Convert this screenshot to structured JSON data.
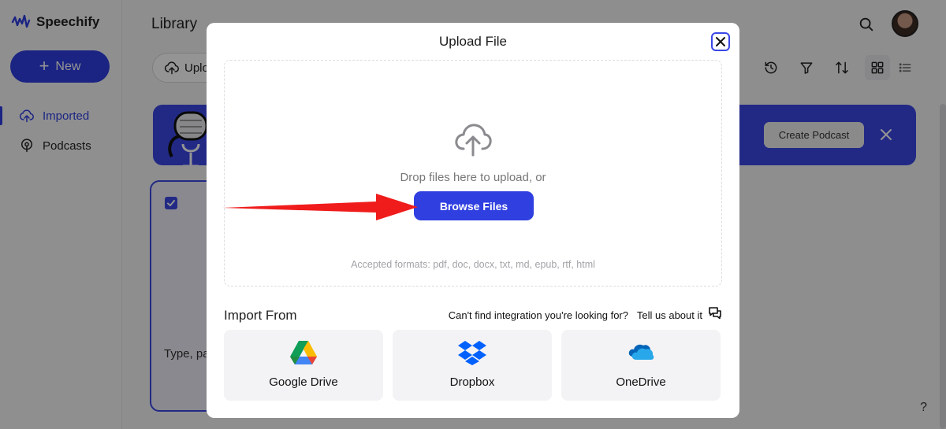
{
  "app": {
    "brand": "Speechify",
    "new_label": "New",
    "nav": [
      {
        "label": "Imported",
        "icon": "upload-cloud-icon",
        "active": true
      },
      {
        "label": "Podcasts",
        "icon": "podcast-icon",
        "active": false
      }
    ],
    "page_title": "Library",
    "upload_label": "Uplo",
    "toolbar_icons": [
      "history-icon",
      "filter-icon",
      "sort-icon",
      "grid-view-icon",
      "list-view-icon"
    ],
    "banner": {
      "create_label": "Create Podcast"
    },
    "card_text": "Type, pa",
    "help_label": "?"
  },
  "modal": {
    "title": "Upload File",
    "drop_text": "Drop files here to upload, or",
    "browse_label": "Browse Files",
    "formats_text": "Accepted formats: pdf, doc, docx, txt, md, epub, rtf, html",
    "import_title": "Import From",
    "integration_question": "Can't find integration you're looking for?",
    "tell_us": "Tell us about it",
    "integrations": [
      {
        "label": "Google Drive",
        "icon": "google-drive-icon"
      },
      {
        "label": "Dropbox",
        "icon": "dropbox-icon"
      },
      {
        "label": "OneDrive",
        "icon": "onedrive-icon"
      }
    ]
  },
  "colors": {
    "accent": "#2f3fe0",
    "annotation_arrow": "#f01c1c"
  }
}
